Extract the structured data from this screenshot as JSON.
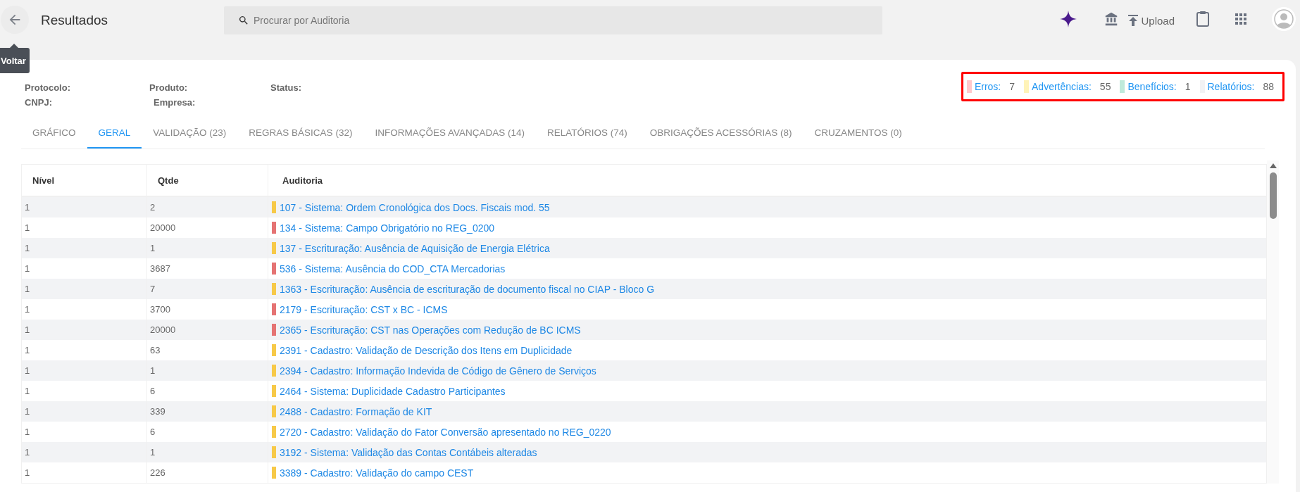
{
  "header": {
    "back_tooltip": "Voltar",
    "title": "Resultados",
    "search": {
      "placeholder": "Procurar por Auditoria"
    },
    "upload_label": "Upload"
  },
  "info": {
    "fields": [
      {
        "label": "Protocolo:"
      },
      {
        "label": "Produto:"
      },
      {
        "label": "Status:"
      },
      {
        "label": "CNPJ:"
      },
      {
        "label": "Empresa:"
      }
    ]
  },
  "legend": [
    {
      "label": "Erros:",
      "count": "7",
      "color": "#ffc9cc"
    },
    {
      "label": "Advertências:",
      "count": "55",
      "color": "#fff3b8"
    },
    {
      "label": "Benefícios:",
      "count": "1",
      "color": "#bfeadb"
    },
    {
      "label": "Relatórios:",
      "count": "88",
      "color": "#f2f2f4"
    }
  ],
  "tabs": [
    {
      "label": "GRÁFICO",
      "selected": false
    },
    {
      "label": "GERAL",
      "selected": true
    },
    {
      "label": "VALIDAÇÃO (23)",
      "selected": false
    },
    {
      "label": "REGRAS BÁSICAS (32)",
      "selected": false
    },
    {
      "label": "INFORMAÇÕES AVANÇADAS (14)",
      "selected": false
    },
    {
      "label": "RELATÓRIOS (74)",
      "selected": false
    },
    {
      "label": "OBRIGAÇÕES ACESSÓRIAS (8)",
      "selected": false
    },
    {
      "label": "CRUZAMENTOS (0)",
      "selected": false
    }
  ],
  "table": {
    "columns": [
      "Nível",
      "Qtde",
      "Auditoria"
    ],
    "rows": [
      {
        "nivel": "1",
        "qtde": "2",
        "auditoria": "107 - Sistema: Ordem Cronológica dos Docs. Fiscais mod. 55",
        "color": "#f7c948"
      },
      {
        "nivel": "1",
        "qtde": "20000",
        "auditoria": "134 - Sistema: Campo Obrigatório no REG_0200",
        "color": "#e57373"
      },
      {
        "nivel": "1",
        "qtde": "1",
        "auditoria": "137 - Escrituração: Ausência de Aquisição de Energia Elétrica",
        "color": "#f7c948"
      },
      {
        "nivel": "1",
        "qtde": "3687",
        "auditoria": "536 - Sistema: Ausência do COD_CTA Mercadorias",
        "color": "#e57373"
      },
      {
        "nivel": "1",
        "qtde": "7",
        "auditoria": "1363 - Escrituração: Ausência de escrituração de documento fiscal no CIAP - Bloco G",
        "color": "#f7c948"
      },
      {
        "nivel": "1",
        "qtde": "3700",
        "auditoria": "2179 - Escrituração: CST x BC - ICMS",
        "color": "#e57373"
      },
      {
        "nivel": "1",
        "qtde": "20000",
        "auditoria": "2365 - Escrituração: CST nas Operações com Redução de BC ICMS",
        "color": "#e57373"
      },
      {
        "nivel": "1",
        "qtde": "63",
        "auditoria": "2391 - Cadastro: Validação de Descrição dos Itens em Duplicidade",
        "color": "#f7c948"
      },
      {
        "nivel": "1",
        "qtde": "1",
        "auditoria": "2394 - Cadastro: Informação Indevida de Código de Gênero de Serviços",
        "color": "#f7c948"
      },
      {
        "nivel": "1",
        "qtde": "6",
        "auditoria": "2464 - Sistema: Duplicidade Cadastro Participantes",
        "color": "#f7c948"
      },
      {
        "nivel": "1",
        "qtde": "339",
        "auditoria": "2488 - Cadastro: Formação de KIT",
        "color": "#f7c948"
      },
      {
        "nivel": "1",
        "qtde": "6",
        "auditoria": "2720 - Cadastro: Validação do Fator Conversão apresentado no REG_0220",
        "color": "#f7c948"
      },
      {
        "nivel": "1",
        "qtde": "1",
        "auditoria": "3192 - Sistema: Validação das Contas Contábeis alteradas",
        "color": "#f7c948"
      },
      {
        "nivel": "1",
        "qtde": "226",
        "auditoria": "3389 - Cadastro: Validação do campo CEST",
        "color": "#f7c948"
      }
    ]
  }
}
